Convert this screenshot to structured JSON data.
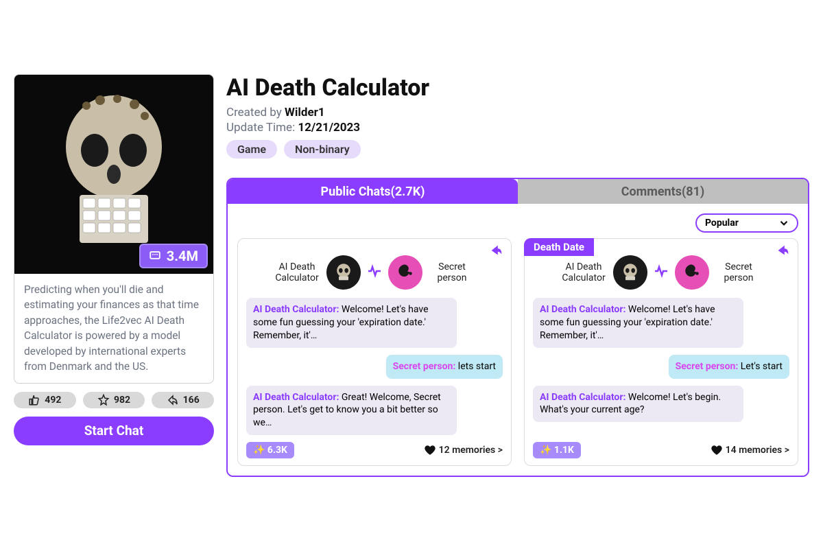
{
  "colors": {
    "accent": "#8b3dff"
  },
  "profile": {
    "views_badge": "3.4M",
    "description": "Predicting when you'll die and estimating your finances as that time approaches, the Life2vec AI Death Calculator is powered by a model developed by international experts from Denmark and the US.",
    "stats": {
      "likes": "492",
      "favorites": "982",
      "shares": "166"
    },
    "start_label": "Start Chat"
  },
  "header": {
    "title": "AI Death Calculator",
    "created_by_prefix": "Created by ",
    "creator": "Wilder1",
    "update_prefix": "Update Time: ",
    "update_time": "12/21/2023",
    "tags": [
      "Game",
      "Non-binary"
    ]
  },
  "tabs": {
    "public_label": "Public Chats(2.7K)",
    "comments_label": "Comments(81)",
    "sort_label": "Popular"
  },
  "chat_cards": [
    {
      "tag": null,
      "bot_name": "AI Death Calculator",
      "person_name": "Secret person",
      "messages": [
        {
          "who": "AI Death Calculator:",
          "role": "bot",
          "text": " Welcome! Let's have some fun guessing your 'expiration date.' Remember, it'…"
        },
        {
          "who": "Secret person:",
          "role": "user",
          "text": " lets start"
        },
        {
          "who": "AI Death Calculator:",
          "role": "bot",
          "text": " Great! Welcome, Secret person. Let's get to know you a bit better so we…"
        }
      ],
      "fire": "6.3K",
      "memories": "12 memories >"
    },
    {
      "tag": "Death Date",
      "bot_name": "AI Death Calculator",
      "person_name": "Secret person",
      "messages": [
        {
          "who": "AI Death Calculator:",
          "role": "bot",
          "text": " Welcome! Let's have some fun guessing your 'expiration date.' Remember, it'…"
        },
        {
          "who": "Secret person:",
          "role": "user",
          "text": " Let's start"
        },
        {
          "who": "AI Death Calculator:",
          "role": "bot",
          "text": " Welcome! Let's begin. What's your current age?"
        }
      ],
      "fire": "1.1K",
      "memories": "14 memories >"
    }
  ]
}
